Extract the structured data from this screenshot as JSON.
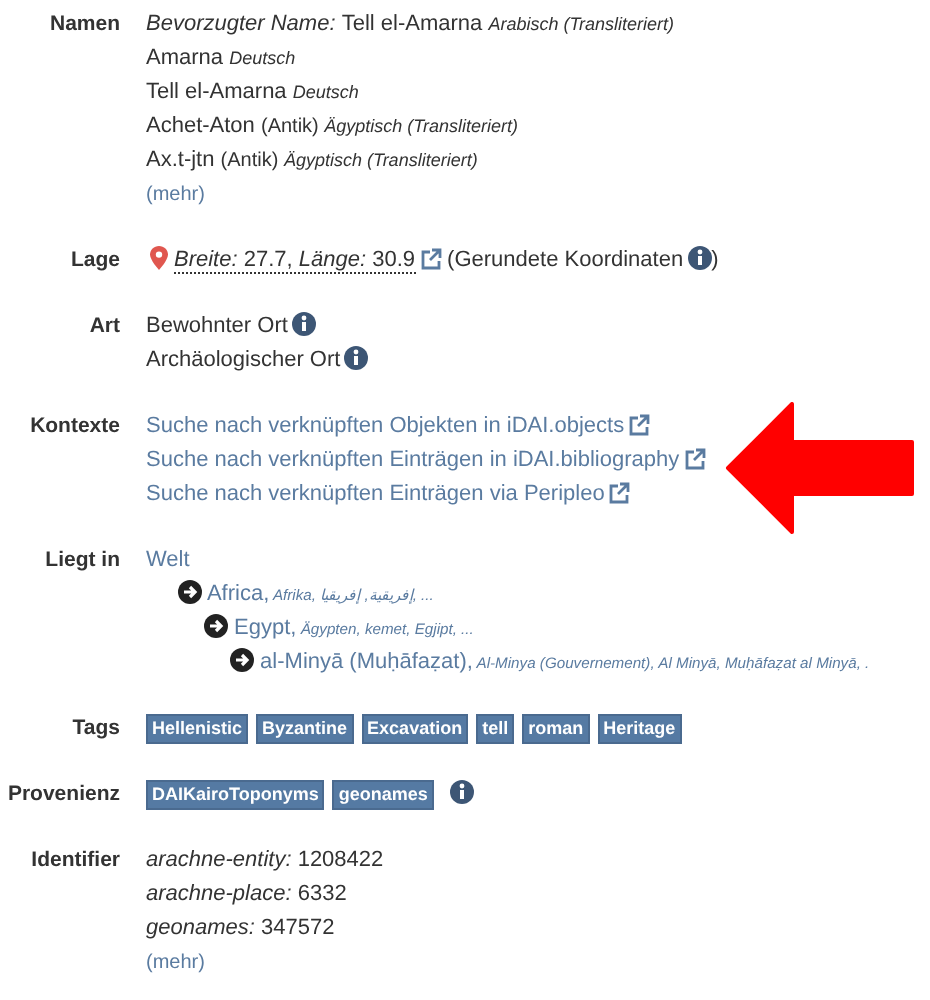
{
  "fields": [
    {
      "kind": "names",
      "label": "Namen",
      "names": [
        {
          "prefix": "Bevorzugter Name:",
          "name": "Tell el-Amarna",
          "language": "Arabisch (Transliteriert)"
        },
        {
          "name": "Amarna",
          "language": "Deutsch"
        },
        {
          "name": "Tell el-Amarna",
          "language": "Deutsch"
        },
        {
          "name": "Achet-Aton",
          "period": "(Antik)",
          "language": "Ägyptisch (Transliteriert)"
        },
        {
          "name": "Ax.t-jtn",
          "period": "(Antik)",
          "language": "Ägyptisch (Transliteriert)"
        }
      ],
      "more": "(mehr)"
    },
    {
      "kind": "location",
      "label": "Lage",
      "lat_label": "Breite:",
      "lat": "27.7,",
      "lon_label": "Länge:",
      "lon": "30.9",
      "note": "(Gerundete Koordinaten",
      "note_end": ")"
    },
    {
      "kind": "types",
      "label": "Art",
      "items": [
        "Bewohnter Ort",
        "Archäologischer Ort"
      ]
    },
    {
      "kind": "links",
      "label": "Kontexte",
      "links": [
        "Suche nach verknüpften Objekten in iDAI.objects",
        "Suche nach verknüpften Einträgen in iDAI.bibliography",
        "Suche nach verknüpften Einträgen via Peripleo"
      ]
    },
    {
      "kind": "hierarchy",
      "label": "Liegt in",
      "root": "Welt",
      "children": [
        {
          "name": "Africa,",
          "alternates": "Afrika, إفريقية, إفريقيا, ...",
          "children": [
            {
              "name": "Egypt,",
              "alternates": "Ägypten, kemet, Egjipt, ...",
              "children": [
                {
                  "name": "al-Minyā (Muḥāfaẓat),",
                  "alternates": "Al-Minya (Gouvernement), Al Minyā, Muḥāfaẓat al Minyā, ."
                }
              ]
            }
          ]
        }
      ]
    },
    {
      "kind": "tags",
      "label": "Tags",
      "tags": [
        "Hellenistic",
        "Byzantine",
        "Excavation",
        "tell",
        "roman",
        "Heritage"
      ]
    },
    {
      "kind": "sources",
      "label": "Provenienz",
      "tags": [
        "DAIKairoToponyms",
        "geonames"
      ]
    },
    {
      "kind": "identifiers",
      "label": "Identifier",
      "items": [
        {
          "key": "arachne-entity:",
          "value": "1208422"
        },
        {
          "key": "arachne-place:",
          "value": "6332"
        },
        {
          "key": "geonames:",
          "value": "347572"
        }
      ],
      "more": "(mehr)"
    }
  ],
  "annotation": {
    "kind": "arrow"
  }
}
